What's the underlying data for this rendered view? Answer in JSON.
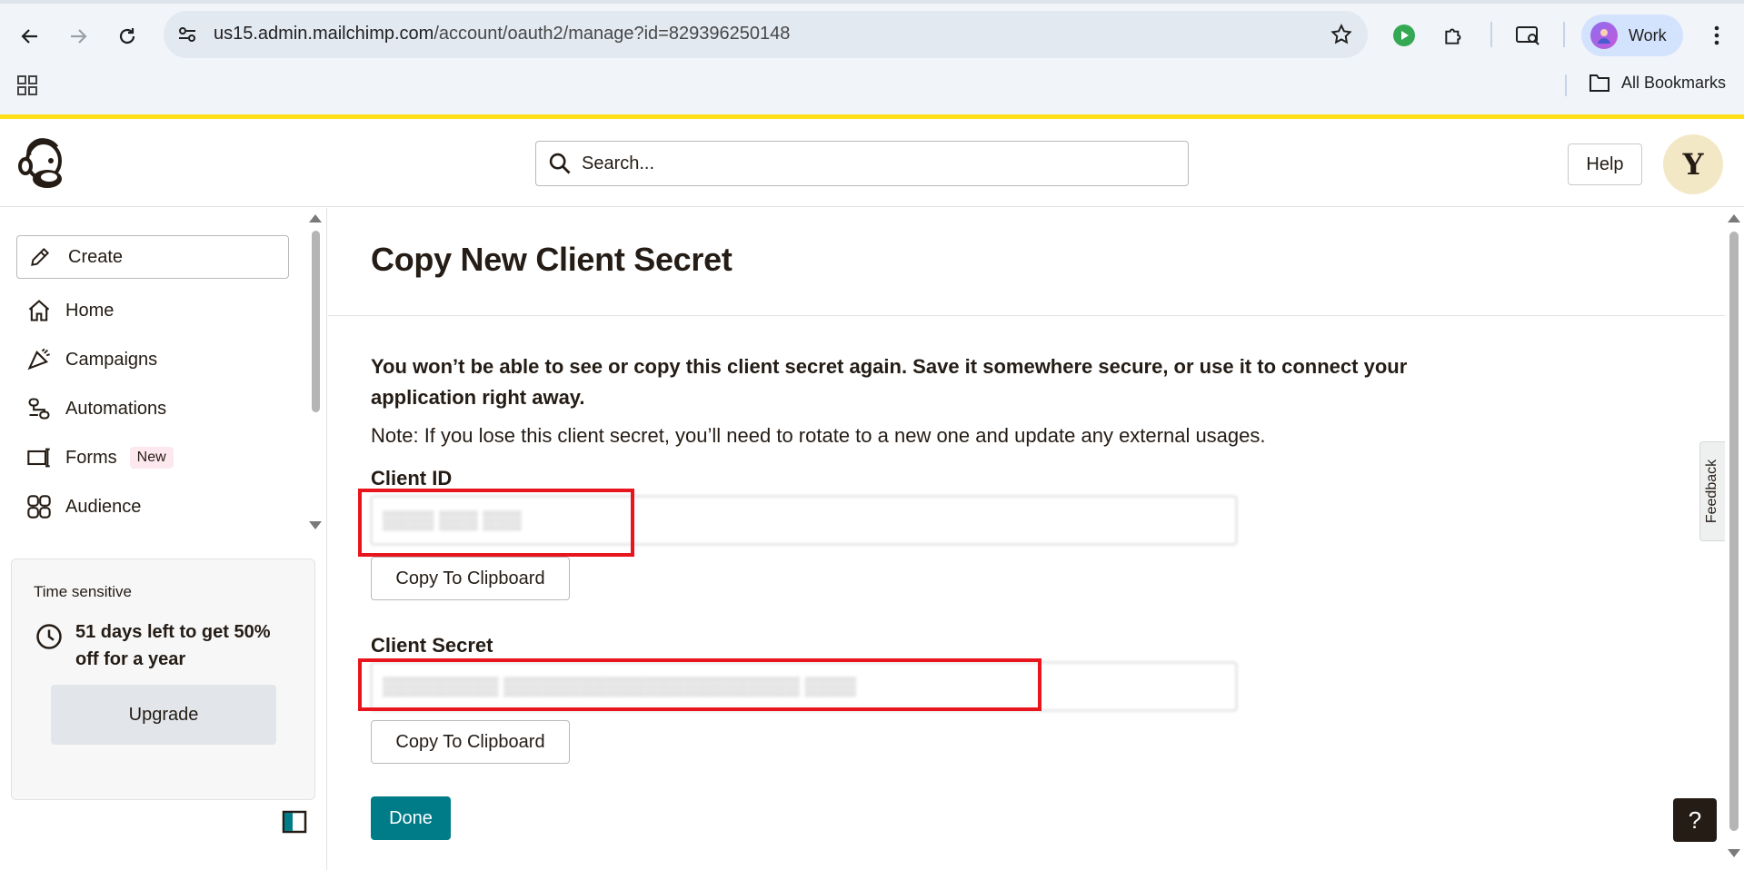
{
  "browser": {
    "url_host": "us15.admin.mailchimp.com",
    "url_path": "/account/oauth2/manage?id=829396250148",
    "profile_name": "Work",
    "bookmarks_label": "All Bookmarks"
  },
  "header": {
    "search_placeholder": "Search...",
    "help_label": "Help",
    "avatar_initial": "Y"
  },
  "sidebar": {
    "create_label": "Create",
    "items": [
      {
        "label": "Home",
        "icon": "home-icon"
      },
      {
        "label": "Campaigns",
        "icon": "megaphone-icon"
      },
      {
        "label": "Automations",
        "icon": "automation-icon"
      },
      {
        "label": "Forms",
        "icon": "forms-icon",
        "badge": "New"
      },
      {
        "label": "Audience",
        "icon": "audience-icon"
      }
    ],
    "promo": {
      "title": "Time sensitive",
      "offer": "51 days left to get 50% off for a year",
      "button": "Upgrade"
    }
  },
  "main": {
    "title": "Copy New Client Secret",
    "warning": "You won’t be able to see or copy this client secret again. Save it somewhere secure, or use it to connect your application right away.",
    "note": "Note: If you lose this client secret, you’ll need to rotate to a new one and update any external usages.",
    "client_id_label": "Client ID",
    "client_secret_label": "Client Secret",
    "copy_label": "Copy To Clipboard",
    "done_label": "Done",
    "feedback_label": "Feedback",
    "help_fab": "?"
  },
  "colors": {
    "brand_yellow": "#ffe01b",
    "primary_teal": "#007c89",
    "highlight_red": "#e8151d",
    "new_badge_bg": "#fde8f0"
  }
}
